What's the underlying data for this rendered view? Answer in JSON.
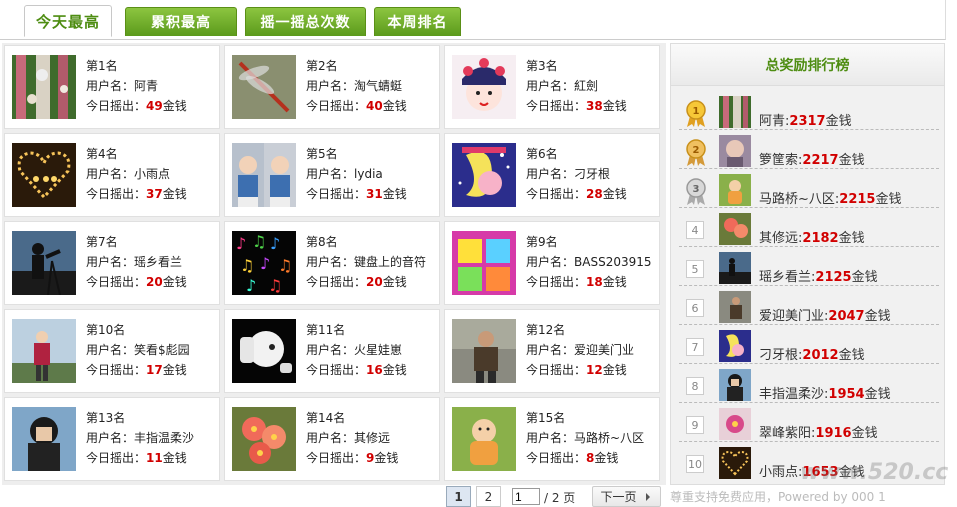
{
  "tabs": [
    "今天最高",
    "累积最高",
    "摇一摇总次数",
    "本周排名"
  ],
  "labels": {
    "user": "用户名：",
    "today": "今日摇出：",
    "coin": "金钱"
  },
  "cards": [
    {
      "rank": "第1名",
      "user": "阿青",
      "amount": "49"
    },
    {
      "rank": "第2名",
      "user": "淘气蜻蜓",
      "amount": "40"
    },
    {
      "rank": "第3名",
      "user": "紅劍",
      "amount": "38"
    },
    {
      "rank": "第4名",
      "user": "小雨点",
      "amount": "37"
    },
    {
      "rank": "第5名",
      "user": "lydia",
      "amount": "31"
    },
    {
      "rank": "第6名",
      "user": "刁牙根",
      "amount": "28"
    },
    {
      "rank": "第7名",
      "user": "瑶乡看兰",
      "amount": "20"
    },
    {
      "rank": "第8名",
      "user": "键盘上的音符",
      "amount": "20"
    },
    {
      "rank": "第9名",
      "user": "BASS203915",
      "amount": "18"
    },
    {
      "rank": "第10名",
      "user": "笑看$彪园",
      "amount": "17"
    },
    {
      "rank": "第11名",
      "user": "火星娃崽",
      "amount": "16"
    },
    {
      "rank": "第12名",
      "user": "爱迎美门业",
      "amount": "12"
    },
    {
      "rank": "第13名",
      "user": "丰指温柔沙",
      "amount": "11"
    },
    {
      "rank": "第14名",
      "user": "其修远",
      "amount": "9"
    },
    {
      "rank": "第15名",
      "user": "马路桥~八区",
      "amount": "8"
    }
  ],
  "pager": {
    "page1": "1",
    "page2": "2",
    "input_value": "1",
    "total": "/ 2 页",
    "next": "下一页"
  },
  "footer_note": "尊重支持免费应用，Powered by 000 1",
  "rank_panel": {
    "title": "总奖励排行榜",
    "rows": [
      {
        "num": "1",
        "name": "阿青",
        "amount": "2317"
      },
      {
        "num": "2",
        "name": "箩筐索",
        "amount": "2217"
      },
      {
        "num": "3",
        "name": "马路桥~八区",
        "amount": "2215"
      },
      {
        "num": "4",
        "name": "其修远",
        "amount": "2182"
      },
      {
        "num": "5",
        "name": "瑶乡看兰",
        "amount": "2125"
      },
      {
        "num": "6",
        "name": "爱迎美门业",
        "amount": "2047"
      },
      {
        "num": "7",
        "name": "刁牙根",
        "amount": "2012"
      },
      {
        "num": "8",
        "name": "丰指温柔沙",
        "amount": "1954"
      },
      {
        "num": "9",
        "name": "翠峰紫阳",
        "amount": "1916"
      },
      {
        "num": "10",
        "name": "小雨点",
        "amount": "1653"
      }
    ]
  },
  "watermark": "www.520.cc",
  "colors": {
    "accent_green": "#4e8d12",
    "amount_red": "#d10000",
    "tab_green": "#6aa826"
  }
}
